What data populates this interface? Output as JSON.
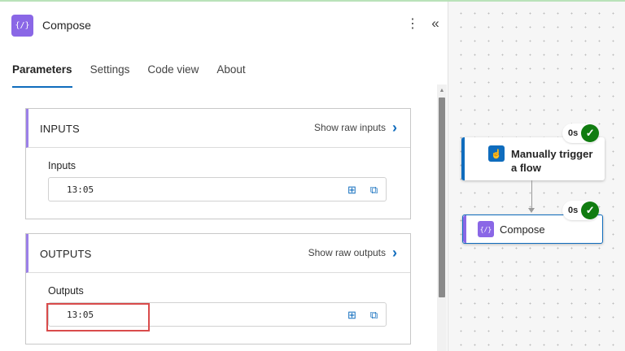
{
  "header": {
    "icon": "compose-icon",
    "icon_glyph": "{/}",
    "title": "Compose",
    "more_icon": "more-vertical-icon",
    "collapse_icon": "double-chevron-left-icon"
  },
  "tabs": [
    {
      "label": "Parameters",
      "active": true
    },
    {
      "label": "Settings",
      "active": false
    },
    {
      "label": "Code view",
      "active": false
    },
    {
      "label": "About",
      "active": false
    }
  ],
  "inputs_card": {
    "title": "INPUTS",
    "raw_link": "Show raw inputs",
    "field_label": "Inputs",
    "value": "13:05"
  },
  "outputs_card": {
    "title": "OUTPUTS",
    "raw_link": "Show raw outputs",
    "field_label": "Outputs",
    "value": "13:05"
  },
  "canvas": {
    "trigger_node": {
      "label": "Manually trigger a flow",
      "icon": "manual-trigger-icon",
      "duration": "0s",
      "status": "succeeded"
    },
    "compose_node": {
      "label": "Compose",
      "icon": "compose-icon",
      "duration": "0s",
      "status": "succeeded"
    }
  },
  "colors": {
    "accent": "#0f6cbd",
    "compose_purple": "#8a67e6",
    "trigger_blue": "#0f6cbd",
    "success_green": "#107c10",
    "highlight_red": "#d94b4b"
  }
}
